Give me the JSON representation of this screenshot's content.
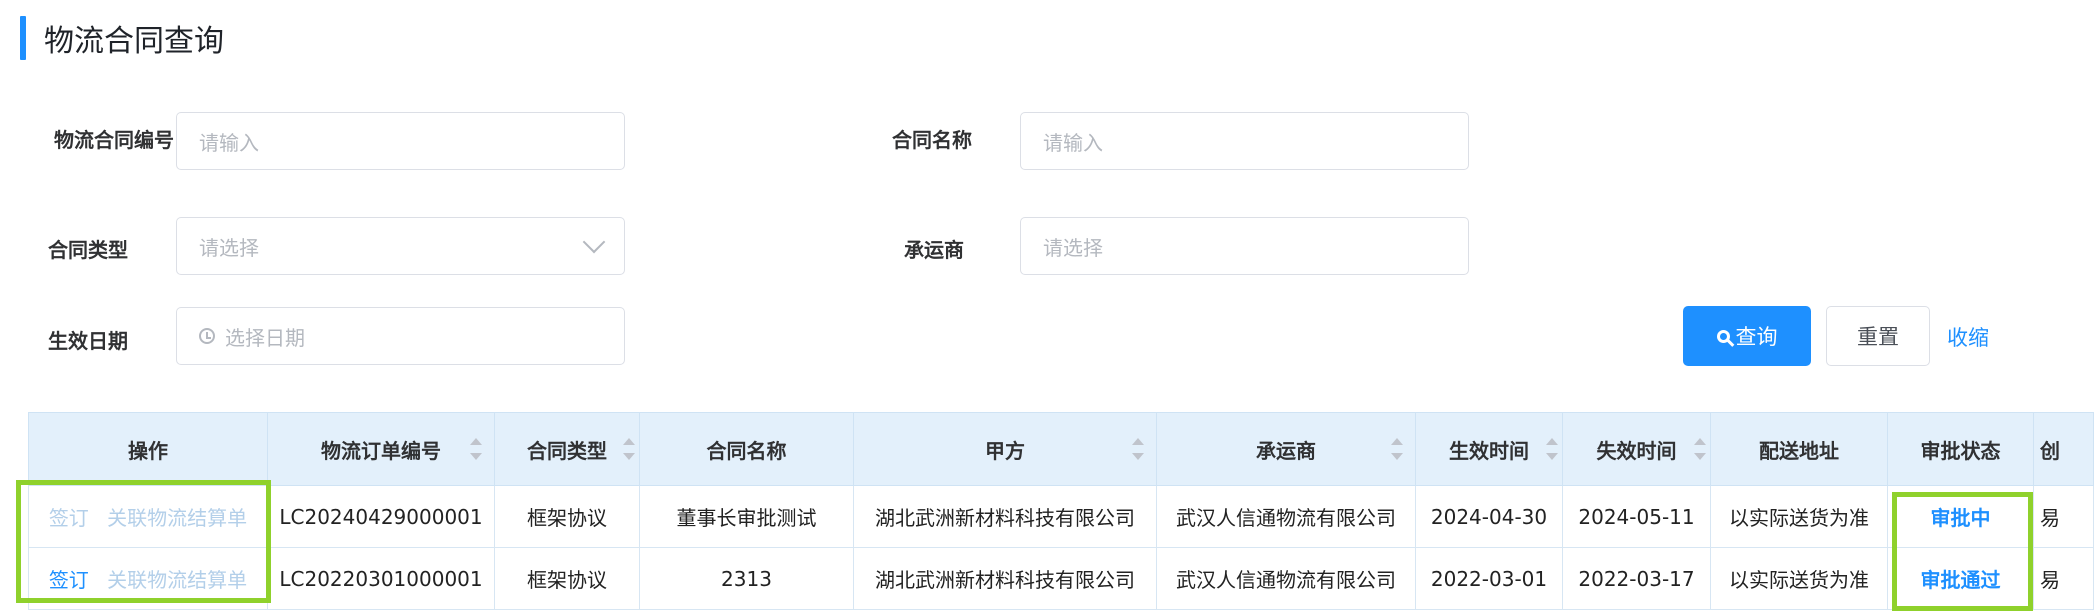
{
  "page": {
    "title": "物流合同查询"
  },
  "form": {
    "contract_no": {
      "label": "物流合同编号",
      "placeholder": "请输入"
    },
    "contract_name": {
      "label": "合同名称",
      "placeholder": "请输入"
    },
    "contract_type": {
      "label": "合同类型",
      "placeholder": "请选择"
    },
    "carrier": {
      "label": "承运商",
      "placeholder": "请选择"
    },
    "effective_date": {
      "label": "生效日期",
      "placeholder": "选择日期"
    }
  },
  "actions": {
    "search": "查询",
    "reset": "重置",
    "collapse": "收缩"
  },
  "table": {
    "headers": [
      "操作",
      "物流订单编号",
      "合同类型",
      "合同名称",
      "甲方",
      "承运商",
      "生效时间",
      "失效时间",
      "配送地址",
      "审批状态",
      "创"
    ],
    "rows": [
      {
        "op_sign": "签订",
        "op_link": "关联物流结算单",
        "order_no": "LC20240429000001",
        "type": "框架协议",
        "name": "董事长审批测试",
        "party_a": "湖北武洲新材料科技有限公司",
        "carrier": "武汉人信通物流有限公司",
        "start": "2024-04-30",
        "end": "2024-05-11",
        "address": "以实际送货为准",
        "status": "审批中",
        "extra": "易"
      },
      {
        "op_sign": "签订",
        "op_link": "关联物流结算单",
        "order_no": "LC20220301000001",
        "type": "框架协议",
        "name": "2313",
        "party_a": "湖北武洲新材料科技有限公司",
        "carrier": "武汉人信通物流有限公司",
        "start": "2022-03-01",
        "end": "2022-03-17",
        "address": "以实际送货为准",
        "status": "审批通过",
        "extra": "易"
      }
    ]
  },
  "colors": {
    "accent": "#1e90ff",
    "header_bg": "#e3f0fb",
    "highlight": "#8fd12c"
  }
}
